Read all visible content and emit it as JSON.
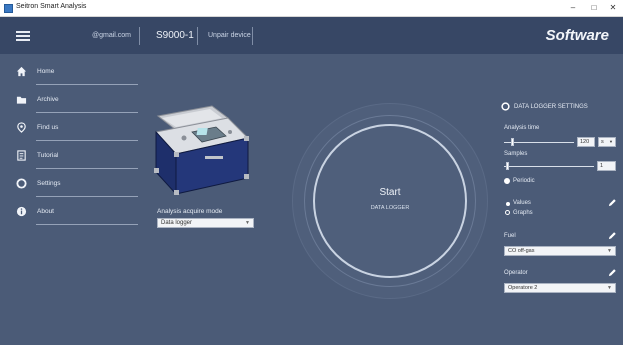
{
  "window": {
    "title": "Seitron Smart Analysis",
    "controls": {
      "minimize": "–",
      "maximize": "□",
      "close": "✕"
    }
  },
  "header": {
    "email": "@gmail.com",
    "device": "S9000-1",
    "unpair": "Unpair device",
    "brand": "Software"
  },
  "sidebar": {
    "items": [
      {
        "label": "Home",
        "icon": "home-icon"
      },
      {
        "label": "Archive",
        "icon": "folder-icon"
      },
      {
        "label": "Find us",
        "icon": "location-icon"
      },
      {
        "label": "Tutorial",
        "icon": "tutorial-icon"
      },
      {
        "label": "Settings",
        "icon": "settings-icon"
      },
      {
        "label": "About",
        "icon": "info-icon"
      }
    ]
  },
  "acquire": {
    "label": "Analysis acquire mode",
    "value": "Data logger"
  },
  "dial": {
    "start": "Start",
    "subtitle": "DATA LOGGER"
  },
  "settings": {
    "title": "DATA LOGGER SETTINGS",
    "analysis_time": {
      "label": "Analysis time",
      "value": "120",
      "unit": "s",
      "level": 0.1
    },
    "samples": {
      "label": "Samples",
      "value": "1",
      "level": 0.02
    },
    "periodic": "Periodic",
    "values": "Values",
    "graphs": "Graphs",
    "fuel": {
      "label": "Fuel",
      "value": "CO off-gas"
    },
    "operator": {
      "label": "Operator",
      "value": "Operatore 2"
    }
  },
  "colors": {
    "header": "#374765",
    "background": "#4b5b77",
    "text": "#e4eaf3"
  }
}
